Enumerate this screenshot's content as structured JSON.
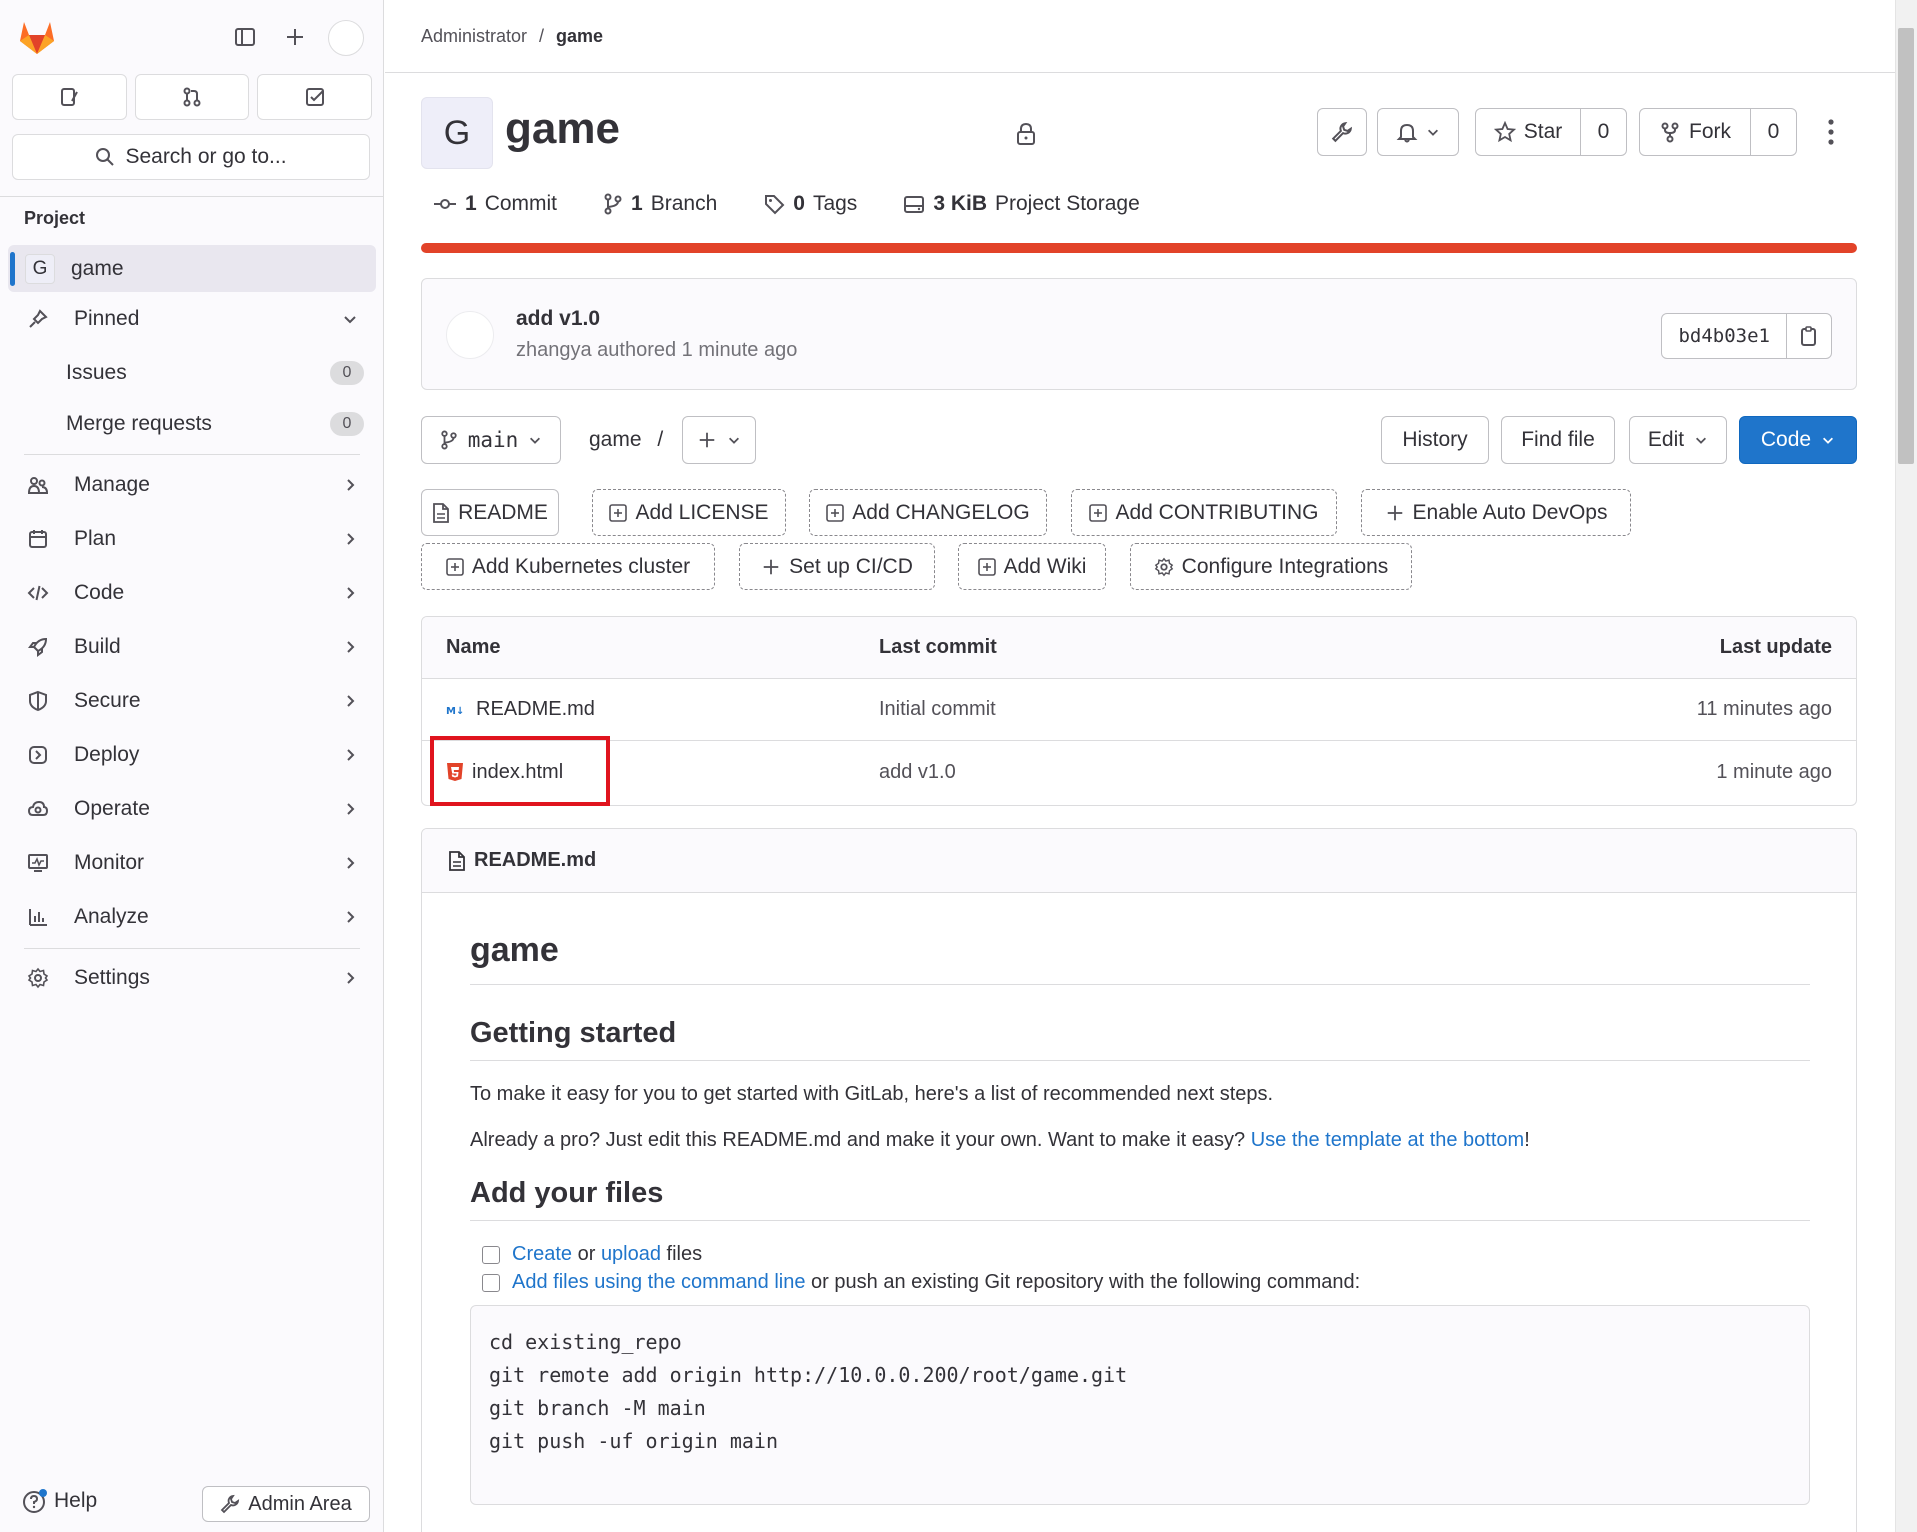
{
  "sidebar": {
    "search_label": "Search or go to...",
    "section_label": "Project",
    "project": {
      "letter": "G",
      "name": "game"
    },
    "pinned": {
      "label": "Pinned",
      "items": [
        {
          "label": "Issues",
          "count": "0"
        },
        {
          "label": "Merge requests",
          "count": "0"
        }
      ]
    },
    "nav": [
      {
        "label": "Manage",
        "icon": "users-icon"
      },
      {
        "label": "Plan",
        "icon": "calendar-icon"
      },
      {
        "label": "Code",
        "icon": "code-icon"
      },
      {
        "label": "Build",
        "icon": "rocket-icon"
      },
      {
        "label": "Secure",
        "icon": "shield-icon"
      },
      {
        "label": "Deploy",
        "icon": "deploy-icon"
      },
      {
        "label": "Operate",
        "icon": "cloud-icon"
      },
      {
        "label": "Monitor",
        "icon": "monitor-icon"
      },
      {
        "label": "Analyze",
        "icon": "chart-icon"
      }
    ],
    "settings_label": "Settings",
    "help_label": "Help",
    "admin_label": "Admin Area"
  },
  "breadcrumb": {
    "parent": "Administrator",
    "separator": "/",
    "current": "game"
  },
  "project": {
    "avatar_letter": "G",
    "title": "game",
    "star_label": "Star",
    "star_count": "0",
    "fork_label": "Fork",
    "fork_count": "0",
    "stats": [
      {
        "value": "1",
        "label": "Commit"
      },
      {
        "value": "1",
        "label": "Branch"
      },
      {
        "value": "0",
        "label": "Tags"
      },
      {
        "value": "3 KiB",
        "label": "Project Storage"
      }
    ],
    "language_color": "#e24329"
  },
  "commit": {
    "title": "add v1.0",
    "meta": "zhangya authored 1 minute ago",
    "sha": "bd4b03e1"
  },
  "repo_nav": {
    "branch": "main",
    "path": "game",
    "path_sep": "/",
    "history": "History",
    "find_file": "Find file",
    "edit": "Edit",
    "code": "Code"
  },
  "shortcuts": [
    "README",
    "Add LICENSE",
    "Add CHANGELOG",
    "Add CONTRIBUTING",
    "Enable Auto DevOps",
    "Add Kubernetes cluster",
    "Set up CI/CD",
    "Add Wiki",
    "Configure Integrations"
  ],
  "files": {
    "headers": {
      "name": "Name",
      "commit": "Last commit",
      "update": "Last update"
    },
    "rows": [
      {
        "name": "README.md",
        "commit": "Initial commit",
        "update": "11 minutes ago",
        "icon": "markdown-icon"
      },
      {
        "name": "index.html",
        "commit": "add v1.0",
        "update": "1 minute ago",
        "icon": "html5-icon"
      }
    ]
  },
  "readme": {
    "filename": "README.md",
    "h1": "game",
    "h2_start": "Getting started",
    "p1": "To make it easy for you to get started with GitLab, here's a list of recommended next steps.",
    "p2_pre": "Already a pro? Just edit this README.md and make it your own. Want to make it easy? ",
    "p2_link": "Use the template at the bottom",
    "p2_post": "!",
    "h2_files": "Add your files",
    "task1_link1": "Create",
    "task1_mid": " or ",
    "task1_link2": "upload",
    "task1_post": " files",
    "task2_link": "Add files using the command line",
    "task2_post": " or push an existing Git repository with the following command:",
    "code_lines": [
      "cd existing_repo",
      "git remote add origin http://10.0.0.200/root/game.git",
      "git branch -M main",
      "git push -uf origin main"
    ]
  }
}
